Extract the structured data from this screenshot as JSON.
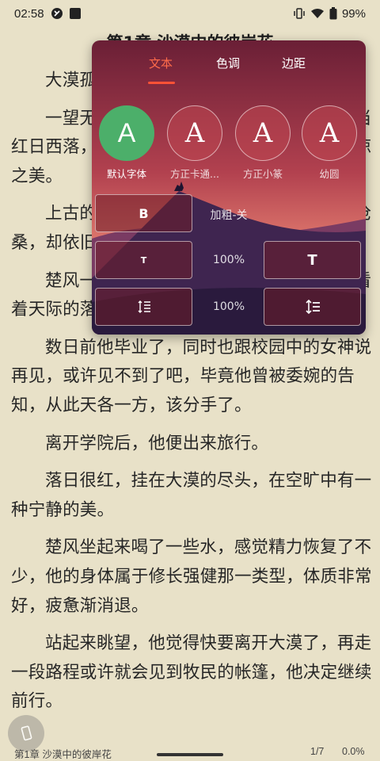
{
  "status_bar": {
    "time": "02:58",
    "battery": "99%"
  },
  "chapter_title": "第1章 沙漠中的彼岸花",
  "paragraphs": [
    "大漠孤烟直，长河落日圆。",
    "一望无际的大漠，宁静而又神秘，雄浑，当红日西落，夕阳西沉，长河磅礴中亦有一种苍凉之美。",
    "上古的大漠，广袤而无垠，古道虽然几经沧桑，却依旧美好。",
    "楚风一人独自在大漠之中，躺在黄沙上，看着天际的落日，不知何时才能离开这片大漠。",
    "数日前他毕业了，同时也跟校园中的女神说再见，或许见不到了吧，毕竟他曾被委婉的告知，从此天各一方，该分手了。",
    "离开学院后，他便出来旅行。",
    "落日很红，挂在大漠的尽头，在空旷中有一种宁静的美。",
    "楚风坐起来喝了一些水，感觉精力恢复了不少，他的身体属于修长强健那一类型，体质非常好，疲惫渐消退。",
    "站起来眺望，他觉得快要离开大漠了，再走一段路程或许就会见到牧民的帐篷，他决定继续前行。"
  ],
  "footer": {
    "chapter": "第1章 沙漠中的彼岸花",
    "page": "1/7",
    "percent": "0.0%"
  },
  "panel": {
    "tabs": [
      "文本",
      "色调",
      "边距"
    ],
    "fonts": [
      {
        "glyph": "A",
        "label": "默认字体"
      },
      {
        "glyph": "A",
        "label": "方正卡通..."
      },
      {
        "glyph": "A",
        "label": "方正小篆"
      },
      {
        "glyph": "A",
        "label": "幼圆"
      }
    ],
    "bold_label": "B",
    "bold_status": "加粗-关",
    "text_size_small": "T",
    "text_size_large": "T",
    "text_size_value": "100%",
    "line_spacing_value": "100%"
  },
  "colors": {
    "background": "#e8e1c8",
    "accent": "#ff5236",
    "selected_font": "#4caf6a"
  }
}
